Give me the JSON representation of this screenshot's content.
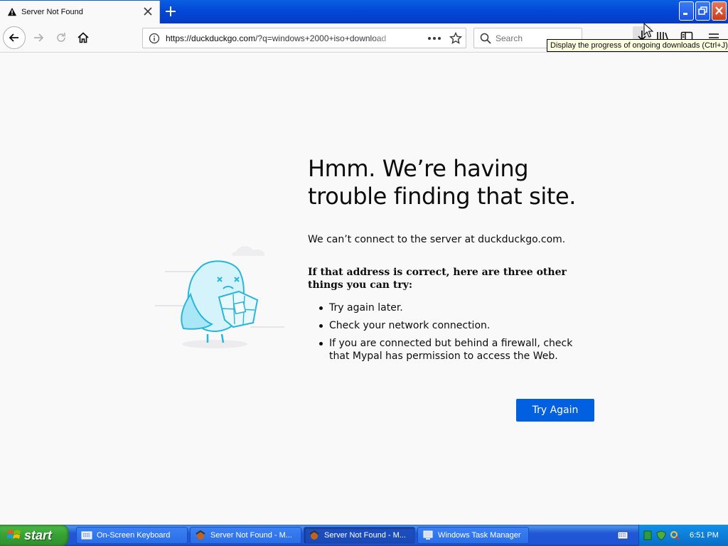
{
  "tab": {
    "title": "Server Not Found"
  },
  "urlbar": {
    "url_host": "https://duckduckgo.com",
    "url_rest": "/?q=windows+2000+iso+download"
  },
  "search": {
    "placeholder": "Search"
  },
  "tooltip": {
    "text": "Display the progress of ongoing downloads (Ctrl+J)"
  },
  "error": {
    "title": "Hmm. We’re having trouble finding that site.",
    "message": "We can’t connect to the server at duckduckgo.com.",
    "suggestion_heading": "If that address is correct, here are three other things you can try:",
    "suggestions": [
      "Try again later.",
      "Check your network connection.",
      "If you are connected but behind a firewall, check that Mypal has permission to access the Web."
    ],
    "try_again_label": "Try Again"
  },
  "taskbar": {
    "start_label": "start",
    "tasks": [
      {
        "label": "On-Screen Keyboard",
        "icon": "keyboard-icon",
        "active": false
      },
      {
        "label": "Server Not Found - M...",
        "icon": "mypal-icon",
        "active": false
      },
      {
        "label": "Server Not Found - M...",
        "icon": "mypal-icon",
        "active": true
      },
      {
        "label": "Windows Task Manager",
        "icon": "task-manager-icon",
        "active": false
      }
    ],
    "clock": "6:51 PM"
  },
  "colors": {
    "accent": "#0060df",
    "titlebar": "#0448d8",
    "taskbar": "#2157d7",
    "start": "#37a034"
  }
}
